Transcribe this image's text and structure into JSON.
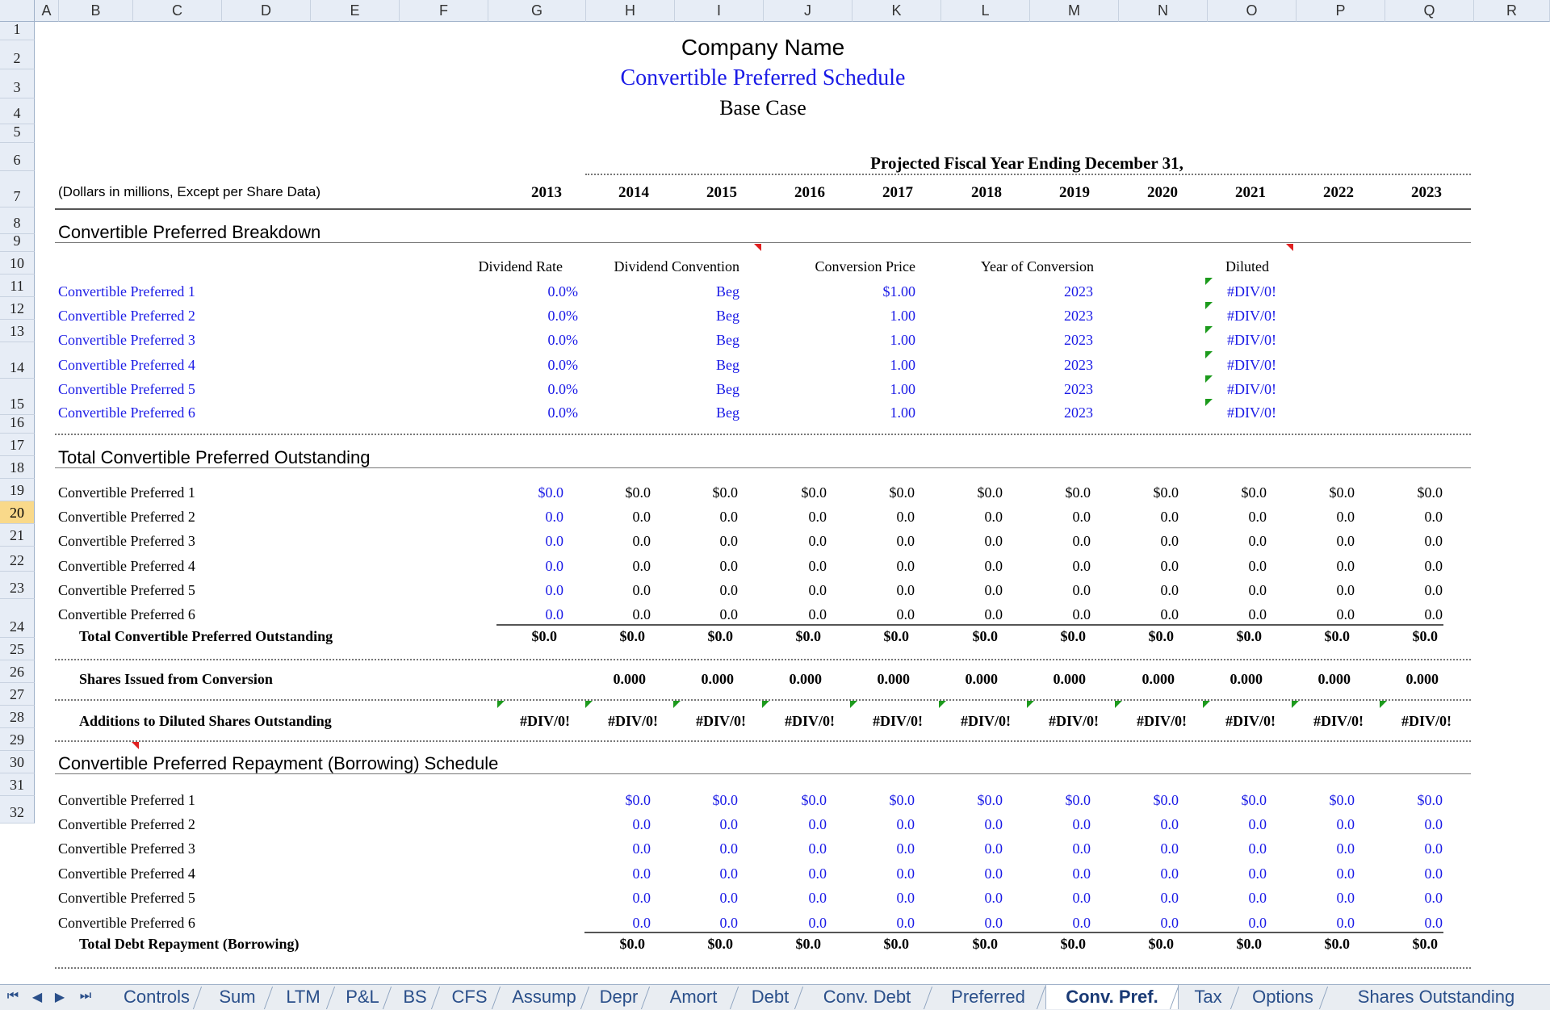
{
  "columns": [
    "A",
    "B",
    "C",
    "D",
    "E",
    "F",
    "G",
    "H",
    "I",
    "J",
    "K",
    "L",
    "M",
    "N",
    "O",
    "P",
    "Q",
    "R"
  ],
  "rows": [
    "1",
    "2",
    "3",
    "4",
    "5",
    "6",
    "7",
    "8",
    "9",
    "10",
    "11",
    "12",
    "13",
    "14",
    "15",
    "16",
    "17",
    "18",
    "19",
    "20",
    "21",
    "22",
    "23",
    "24",
    "25",
    "26",
    "27",
    "28",
    "29",
    "30",
    "31",
    "32"
  ],
  "selected_row": "20",
  "title": {
    "company": "Company Name",
    "schedule": "Convertible Preferred Schedule",
    "scenario": "Base Case"
  },
  "header": {
    "projected": "Projected Fiscal Year Ending December 31,",
    "units": "(Dollars in millions, Except per Share Data)",
    "years": [
      "2013",
      "2014",
      "2015",
      "2016",
      "2017",
      "2018",
      "2019",
      "2020",
      "2021",
      "2022",
      "2023"
    ]
  },
  "breakdown": {
    "section_title": "Convertible Preferred Breakdown",
    "headers": {
      "dividend_rate": "Dividend Rate",
      "dividend_convention": "Dividend Convention",
      "conversion_price": "Conversion Price",
      "year_of_conversion": "Year of Conversion",
      "diluted": "Diluted"
    },
    "rows": [
      {
        "name": "Convertible Preferred 1",
        "rate": "0.0%",
        "convention": "Beg",
        "price": "$1.00",
        "year": "2023",
        "diluted": "#DIV/0!"
      },
      {
        "name": "Convertible Preferred 2",
        "rate": "0.0%",
        "convention": "Beg",
        "price": "1.00",
        "year": "2023",
        "diluted": "#DIV/0!"
      },
      {
        "name": "Convertible Preferred 3",
        "rate": "0.0%",
        "convention": "Beg",
        "price": "1.00",
        "year": "2023",
        "diluted": "#DIV/0!"
      },
      {
        "name": "Convertible Preferred 4",
        "rate": "0.0%",
        "convention": "Beg",
        "price": "1.00",
        "year": "2023",
        "diluted": "#DIV/0!"
      },
      {
        "name": "Convertible Preferred 5",
        "rate": "0.0%",
        "convention": "Beg",
        "price": "1.00",
        "year": "2023",
        "diluted": "#DIV/0!"
      },
      {
        "name": "Convertible Preferred 6",
        "rate": "0.0%",
        "convention": "Beg",
        "price": "1.00",
        "year": "2023",
        "diluted": "#DIV/0!"
      }
    ]
  },
  "outstanding": {
    "section_title": "Total Convertible Preferred Outstanding",
    "rows": [
      {
        "name": "Convertible Preferred 1",
        "values": [
          "$0.0",
          "$0.0",
          "$0.0",
          "$0.0",
          "$0.0",
          "$0.0",
          "$0.0",
          "$0.0",
          "$0.0",
          "$0.0",
          "$0.0"
        ]
      },
      {
        "name": "Convertible Preferred 2",
        "values": [
          "0.0",
          "0.0",
          "0.0",
          "0.0",
          "0.0",
          "0.0",
          "0.0",
          "0.0",
          "0.0",
          "0.0",
          "0.0"
        ]
      },
      {
        "name": "Convertible Preferred 3",
        "values": [
          "0.0",
          "0.0",
          "0.0",
          "0.0",
          "0.0",
          "0.0",
          "0.0",
          "0.0",
          "0.0",
          "0.0",
          "0.0"
        ]
      },
      {
        "name": "Convertible Preferred 4",
        "values": [
          "0.0",
          "0.0",
          "0.0",
          "0.0",
          "0.0",
          "0.0",
          "0.0",
          "0.0",
          "0.0",
          "0.0",
          "0.0"
        ]
      },
      {
        "name": "Convertible Preferred 5",
        "values": [
          "0.0",
          "0.0",
          "0.0",
          "0.0",
          "0.0",
          "0.0",
          "0.0",
          "0.0",
          "0.0",
          "0.0",
          "0.0"
        ]
      },
      {
        "name": "Convertible Preferred 6",
        "values": [
          "0.0",
          "0.0",
          "0.0",
          "0.0",
          "0.0",
          "0.0",
          "0.0",
          "0.0",
          "0.0",
          "0.0",
          "0.0"
        ]
      }
    ],
    "total_label": "Total Convertible Preferred Outstanding",
    "total_values": [
      "$0.0",
      "$0.0",
      "$0.0",
      "$0.0",
      "$0.0",
      "$0.0",
      "$0.0",
      "$0.0",
      "$0.0",
      "$0.0",
      "$0.0"
    ]
  },
  "shares_issued": {
    "label": "Shares Issued from Conversion",
    "values": [
      "0.000",
      "0.000",
      "0.000",
      "0.000",
      "0.000",
      "0.000",
      "0.000",
      "0.000",
      "0.000",
      "0.000"
    ]
  },
  "additions": {
    "label": "Additions to Diluted Shares Outstanding",
    "values": [
      "#DIV/0!",
      "#DIV/0!",
      "#DIV/0!",
      "#DIV/0!",
      "#DIV/0!",
      "#DIV/0!",
      "#DIV/0!",
      "#DIV/0!",
      "#DIV/0!",
      "#DIV/0!",
      "#DIV/0!"
    ]
  },
  "repayment": {
    "section_title": "Convertible Preferred Repayment (Borrowing) Schedule",
    "rows": [
      {
        "name": "Convertible Preferred 1",
        "values": [
          "$0.0",
          "$0.0",
          "$0.0",
          "$0.0",
          "$0.0",
          "$0.0",
          "$0.0",
          "$0.0",
          "$0.0",
          "$0.0"
        ]
      },
      {
        "name": "Convertible Preferred 2",
        "values": [
          "0.0",
          "0.0",
          "0.0",
          "0.0",
          "0.0",
          "0.0",
          "0.0",
          "0.0",
          "0.0",
          "0.0"
        ]
      },
      {
        "name": "Convertible Preferred 3",
        "values": [
          "0.0",
          "0.0",
          "0.0",
          "0.0",
          "0.0",
          "0.0",
          "0.0",
          "0.0",
          "0.0",
          "0.0"
        ]
      },
      {
        "name": "Convertible Preferred 4",
        "values": [
          "0.0",
          "0.0",
          "0.0",
          "0.0",
          "0.0",
          "0.0",
          "0.0",
          "0.0",
          "0.0",
          "0.0"
        ]
      },
      {
        "name": "Convertible Preferred 5",
        "values": [
          "0.0",
          "0.0",
          "0.0",
          "0.0",
          "0.0",
          "0.0",
          "0.0",
          "0.0",
          "0.0",
          "0.0"
        ]
      },
      {
        "name": "Convertible Preferred 6",
        "values": [
          "0.0",
          "0.0",
          "0.0",
          "0.0",
          "0.0",
          "0.0",
          "0.0",
          "0.0",
          "0.0",
          "0.0"
        ]
      }
    ],
    "total_label": "Total Debt Repayment (Borrowing)",
    "total_values": [
      "$0.0",
      "$0.0",
      "$0.0",
      "$0.0",
      "$0.0",
      "$0.0",
      "$0.0",
      "$0.0",
      "$0.0",
      "$0.0"
    ]
  },
  "sheet_tabs": [
    "Controls",
    "Sum",
    "LTM",
    "P&L",
    "BS",
    "CFS",
    "Assump",
    "Depr",
    "Amort",
    "Debt",
    "Conv. Debt",
    "Preferred",
    "Conv. Pref.",
    "Tax",
    "Options",
    "Shares Outstanding"
  ],
  "active_tab": "Conv. Pref.",
  "nav_icons": [
    "first-sheet-icon",
    "prev-sheet-icon",
    "next-sheet-icon",
    "last-sheet-icon"
  ],
  "colors": {
    "input_blue": "#1a1ae6",
    "header_bg": "#e7edf6",
    "selected_row_bg": "#f9d98a",
    "error_flag": "#1c9a1c",
    "comment_flag": "#e02020"
  }
}
